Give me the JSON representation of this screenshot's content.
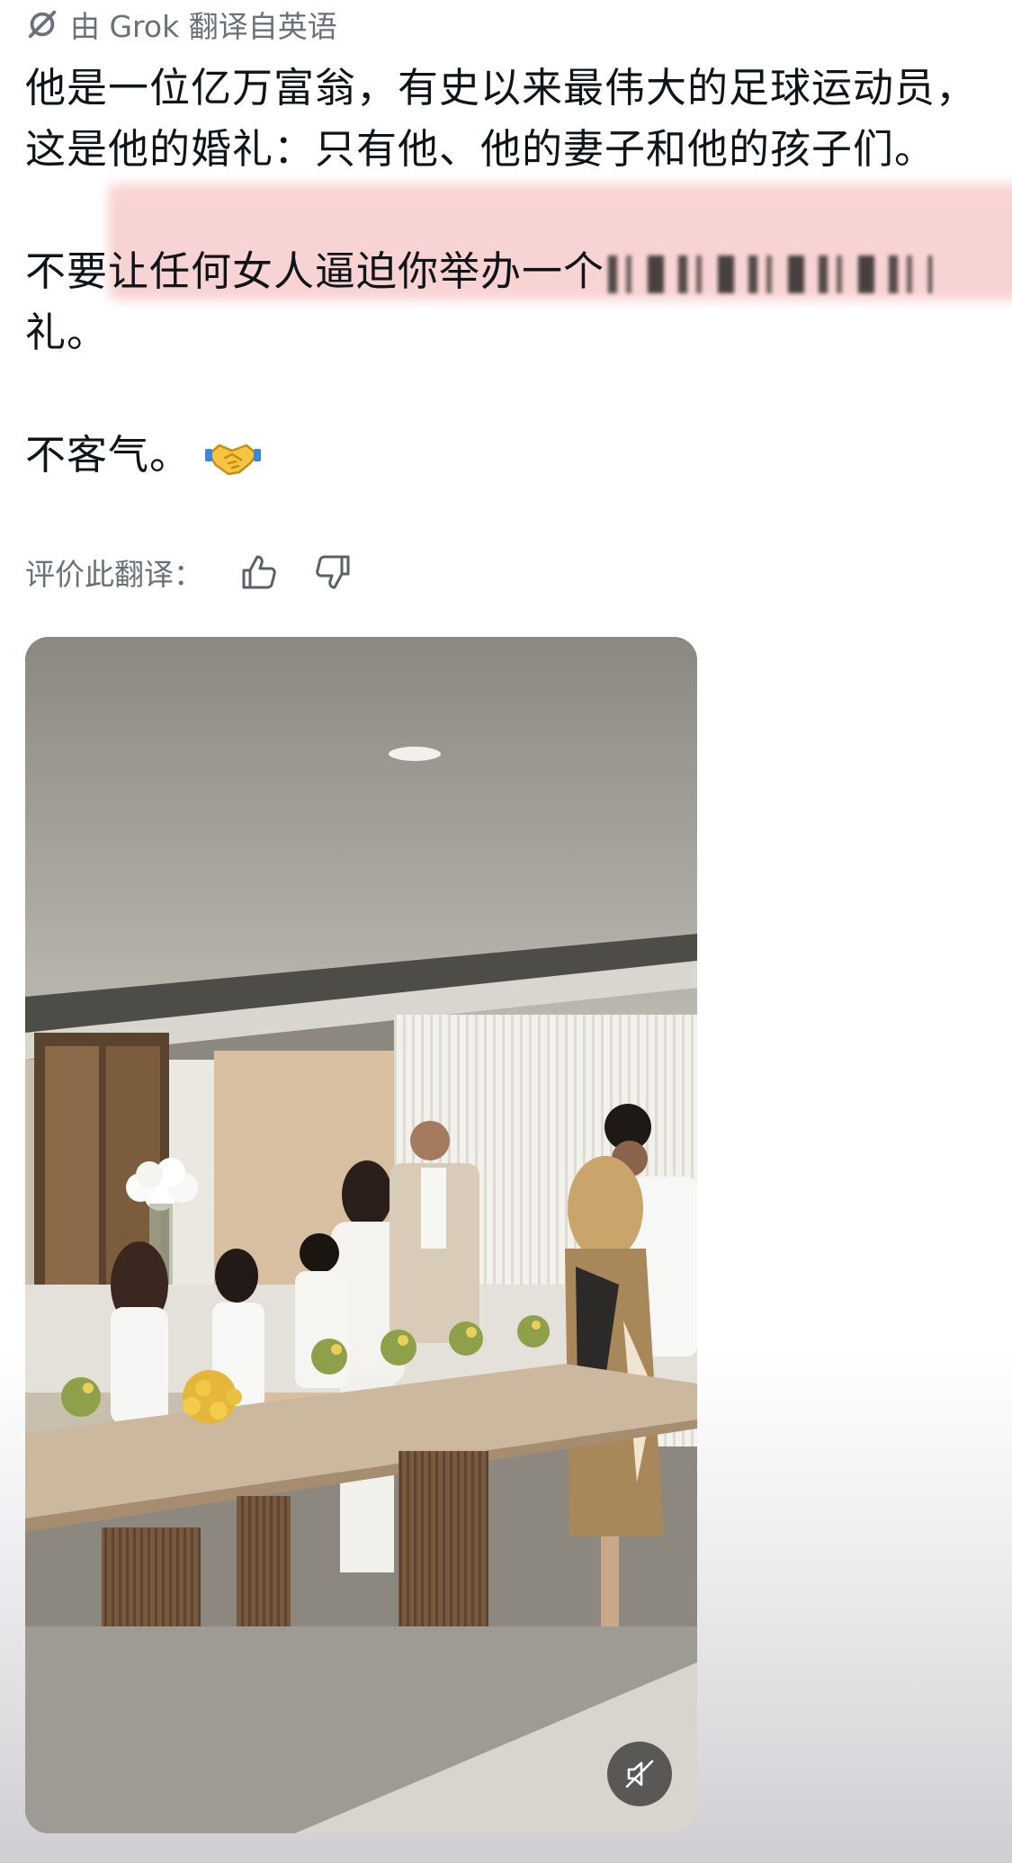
{
  "translation_header": {
    "icon": "grok-slash-icon",
    "label": "由 Grok 翻译自英语"
  },
  "post": {
    "paragraph1": "他是一位亿万富翁，有史以来最伟大的足球运动员，这是他的婚礼：只有他、他的妻子和他的孩子们。",
    "paragraph2_visible_start": "不要让任何女人逼迫你举办一个",
    "paragraph2_end": "礼。",
    "paragraph3": "不客气。",
    "emoji": "handshake-emoji"
  },
  "rating": {
    "label": "评价此翻译：",
    "thumbs_up_icon": "thumbs-up-icon",
    "thumbs_down_icon": "thumbs-down-icon"
  },
  "video": {
    "mute_icon": "muted-speaker-icon"
  },
  "colors": {
    "text": "#0f1419",
    "secondary_text": "#6b7177",
    "highlight": "#ef9696"
  }
}
